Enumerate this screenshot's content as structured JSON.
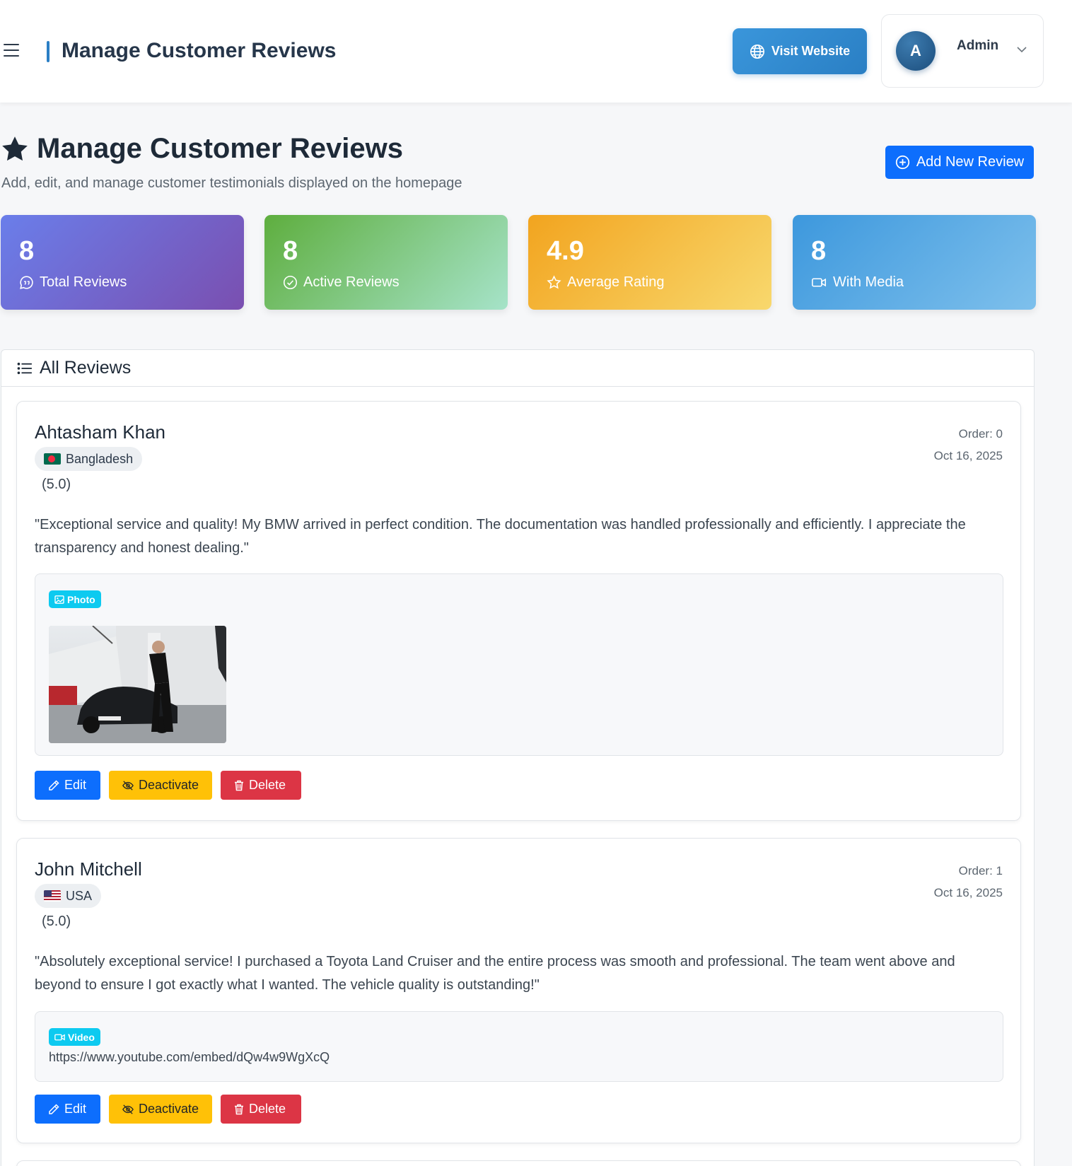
{
  "topbar": {
    "title": "Manage Customer Reviews",
    "visit_label": "Visit Website",
    "admin_initial": "A",
    "admin_name": "Admin"
  },
  "header": {
    "title": "Manage Customer Reviews",
    "subtitle": "Add, edit, and manage customer testimonials displayed on the homepage",
    "add_label": "Add New Review"
  },
  "stats": [
    {
      "value": "8",
      "label": "Total Reviews",
      "icon": "chat-quote-icon",
      "color": "#6a7eea"
    },
    {
      "value": "8",
      "label": "Active Reviews",
      "icon": "check-circle-icon",
      "color": "#5eae3e"
    },
    {
      "value": "4.9",
      "label": "Average Rating",
      "icon": "star-outline-icon",
      "color": "#f2a41f"
    },
    {
      "value": "8",
      "label": "With Media",
      "icon": "camera-video-icon",
      "color": "#3d98dd"
    }
  ],
  "panel": {
    "title": "All Reviews"
  },
  "reviews": [
    {
      "name": "Ahtasham Khan",
      "country": "Bangladesh",
      "rating": "(5.0)",
      "order": "Order: 0",
      "date": "Oct 16, 2025",
      "text": "\"Exceptional service and quality! My BMW arrived in perfect condition. The documentation was handled professionally and efficiently. I appreciate the transparency and honest dealing.\"",
      "media_type": "Photo"
    },
    {
      "name": "John Mitchell",
      "country": "USA",
      "rating": "(5.0)",
      "order": "Order: 1",
      "date": "Oct 16, 2025",
      "text": "\"Absolutely exceptional service! I purchased a Toyota Land Cruiser and the entire process was smooth and professional. The team went above and beyond to ensure I got exactly what I wanted. The vehicle quality is outstanding!\"",
      "media_type": "Video",
      "media_url": "https://www.youtube.com/embed/dQw4w9WgXcQ"
    }
  ],
  "actions": {
    "edit": "Edit",
    "deactivate": "Deactivate",
    "delete": "Delete"
  },
  "colors": {
    "primary": "#0d6efd",
    "warning": "#ffc107",
    "danger": "#dc3545",
    "info": "#0dcaf0"
  }
}
